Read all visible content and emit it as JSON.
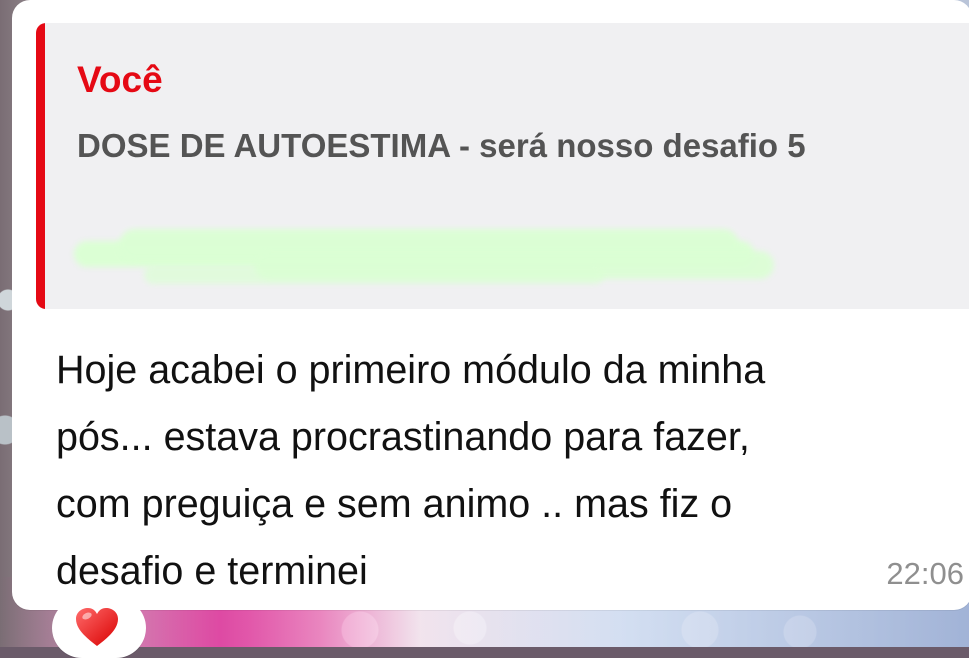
{
  "message": {
    "quoted_author": "Você",
    "quoted_text": "DOSE DE AUTOESTIMA - será nosso desafio 5",
    "body": "Hoje acabei o primeiro módulo da minha\npós... estava procrastinando para fazer,\ncom preguiça e sem animo .. mas fiz o\ndesafio e terminei",
    "timestamp": "22:06"
  },
  "reaction": {
    "icon": "red-heart-icon"
  },
  "colors": {
    "accent": "#e50914",
    "bubble": "#ffffff",
    "quote_background": "#f0f0f2",
    "timestamp": "#8f8f8f"
  }
}
